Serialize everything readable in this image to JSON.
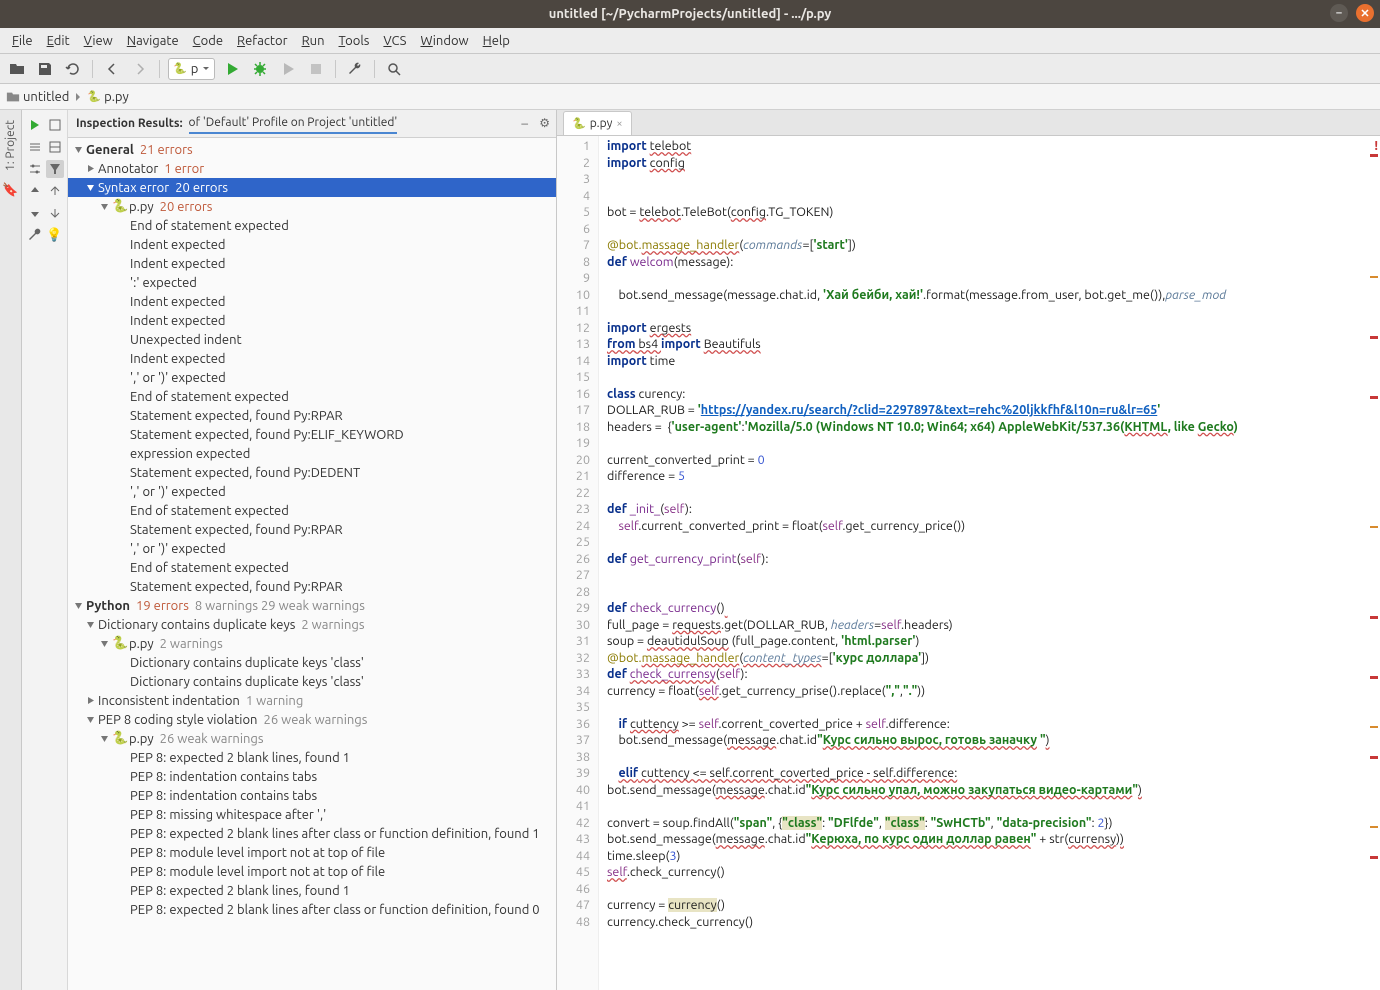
{
  "titlebar": {
    "title": "untitled [~/PycharmProjects/untitled] - .../p.py"
  },
  "menubar": [
    "File",
    "Edit",
    "View",
    "Navigate",
    "Code",
    "Refactor",
    "Run",
    "Tools",
    "VCS",
    "Window",
    "Help"
  ],
  "runconfig": {
    "label": "p"
  },
  "breadcrumb": [
    {
      "icon": "folder",
      "label": "untitled"
    },
    {
      "icon": "pyfile",
      "label": "p.py"
    }
  ],
  "sidebar": {
    "project_label": "1: Project"
  },
  "inspection": {
    "header_label": "Inspection Results:",
    "profile": "of 'Default' Profile on Project 'untitled'"
  },
  "tree": [
    {
      "d": 0,
      "tw": "down",
      "bold": true,
      "label": "General",
      "suffix": "21 errors",
      "cls": "err"
    },
    {
      "d": 1,
      "tw": "right",
      "label": "Annotator",
      "suffix": "1 error",
      "cls": "err"
    },
    {
      "d": 1,
      "tw": "down",
      "label": "Syntax error",
      "suffix": "20 errors",
      "cls": "err",
      "selected": true
    },
    {
      "d": 2,
      "tw": "down",
      "icon": "pyfile",
      "label": "p.py",
      "suffix": "20 errors",
      "cls": "err"
    },
    {
      "d": 3,
      "label": "End of statement expected"
    },
    {
      "d": 3,
      "label": "Indent expected"
    },
    {
      "d": 3,
      "label": "Indent expected"
    },
    {
      "d": 3,
      "label": "':' expected"
    },
    {
      "d": 3,
      "label": "Indent expected"
    },
    {
      "d": 3,
      "label": "Indent expected"
    },
    {
      "d": 3,
      "label": "Unexpected indent"
    },
    {
      "d": 3,
      "label": "Indent expected"
    },
    {
      "d": 3,
      "label": "',' or ')' expected"
    },
    {
      "d": 3,
      "label": "End of statement expected"
    },
    {
      "d": 3,
      "label": "Statement expected, found Py:RPAR"
    },
    {
      "d": 3,
      "label": "Statement expected, found Py:ELIF_KEYWORD"
    },
    {
      "d": 3,
      "label": "expression expected"
    },
    {
      "d": 3,
      "label": "Statement expected, found Py:DEDENT"
    },
    {
      "d": 3,
      "label": "',' or ')' expected"
    },
    {
      "d": 3,
      "label": "End of statement expected"
    },
    {
      "d": 3,
      "label": "Statement expected, found Py:RPAR"
    },
    {
      "d": 3,
      "label": "',' or ')' expected"
    },
    {
      "d": 3,
      "label": "End of statement expected"
    },
    {
      "d": 3,
      "label": "Statement expected, found Py:RPAR"
    },
    {
      "d": 0,
      "tw": "down",
      "bold": true,
      "label": "Python",
      "suffix": "19 errors",
      "cls": "err",
      "suffix2": "8 warnings 29 weak warnings",
      "cls2": "warn"
    },
    {
      "d": 1,
      "tw": "down",
      "label": "Dictionary contains duplicate keys",
      "suffix": "2 warnings",
      "cls": "warn"
    },
    {
      "d": 2,
      "tw": "down",
      "icon": "pyfile",
      "label": "p.py",
      "suffix": "2 warnings",
      "cls": "warn"
    },
    {
      "d": 3,
      "label": "Dictionary contains duplicate keys 'class'"
    },
    {
      "d": 3,
      "label": "Dictionary contains duplicate keys 'class'"
    },
    {
      "d": 1,
      "tw": "right",
      "label": "Inconsistent indentation",
      "suffix": "1 warning",
      "cls": "warn"
    },
    {
      "d": 1,
      "tw": "down",
      "label": "PEP 8 coding style violation",
      "suffix": "26 weak warnings",
      "cls": "warn"
    },
    {
      "d": 2,
      "tw": "down",
      "icon": "pyfile",
      "label": "p.py",
      "suffix": "26 weak warnings",
      "cls": "warn"
    },
    {
      "d": 3,
      "label": "PEP 8: expected 2 blank lines, found 1"
    },
    {
      "d": 3,
      "label": "PEP 8: indentation contains tabs"
    },
    {
      "d": 3,
      "label": "PEP 8: indentation contains tabs"
    },
    {
      "d": 3,
      "label": "PEP 8: missing whitespace after ','"
    },
    {
      "d": 3,
      "label": "PEP 8: expected 2 blank lines after class or function definition, found 1"
    },
    {
      "d": 3,
      "label": "PEP 8: module level import not at top of file"
    },
    {
      "d": 3,
      "label": "PEP 8: module level import not at top of file"
    },
    {
      "d": 3,
      "label": "PEP 8: expected 2 blank lines, found 1"
    },
    {
      "d": 3,
      "label": "PEP 8: expected 2 blank lines after class or function definition, found 0"
    }
  ],
  "editor": {
    "tab": "p.py",
    "lines_from": 1,
    "lines_to": 48,
    "code": [
      {
        "n": 1,
        "t": "<span class='kw'>import</span> <span class='squiggle'>telebot</span>"
      },
      {
        "n": 2,
        "t": "<span class='kw'>import</span> <span class='squiggle'>config</span>"
      },
      {
        "n": 3,
        "t": ""
      },
      {
        "n": 4,
        "t": ""
      },
      {
        "n": 5,
        "t": "bot = <span class='squiggle'>telebot</span>.TeleBot(<span class='squiggle'>config</span>.TG_TOKEN)"
      },
      {
        "n": 6,
        "t": ""
      },
      {
        "n": 7,
        "t": "<span class='dec'>@bot.<span class='squiggle'>massage_handler</span></span>(<span class='param'>commands</span>=[<span class='str'>'start'</span>])"
      },
      {
        "n": 8,
        "t": "<span class='kw'>def </span><span class='fn'>welcom</span>(message):"
      },
      {
        "n": 9,
        "t": ""
      },
      {
        "n": 10,
        "t": "    bot.send_message(message.chat.id, <span class='str'>'Хай бейби, хай!'</span>.format(message.from_user, bot.get_me()),<span class='param'>parse_mod</span>"
      },
      {
        "n": 11,
        "t": ""
      },
      {
        "n": 12,
        "t": "<span class='kw'>import</span> <span class='squiggle'>ergests</span>"
      },
      {
        "n": 13,
        "t": "<span class='kw'><span class='squiggle'>from</span></span><span class='squiggle'> bs4 </span><span class='kw'>import</span> <span class='squiggle'>Beautifuls</span>"
      },
      {
        "n": 14,
        "t": "<span class='kw'>import</span> time"
      },
      {
        "n": 15,
        "t": ""
      },
      {
        "n": 16,
        "t": "<span class='kw'>class</span> curency:"
      },
      {
        "n": 17,
        "t": "DOLLAR_RUB = <span class='str'>'<span class='url'>https://yandex.ru/search/?clid=2297897&amp;text=rehc%20ljkkfhf&amp;l10n=ru&amp;lr=65</span>'</span>"
      },
      {
        "n": 18,
        "t": "headers =  {<span class='str'>'user-agent'</span>:<span class='str'>'Mozilla/5.0 (Windows NT 10.0; Win64; x64) AppleWebKit/537.36(<span class='squiggle'>KHTML</span>, like <span class='squiggle'>Gecko</span>)</span>"
      },
      {
        "n": 19,
        "t": ""
      },
      {
        "n": 20,
        "t": "current_converted_print = <span class='num'>0</span>"
      },
      {
        "n": 21,
        "t": "difference = <span class='num'>5</span>"
      },
      {
        "n": 22,
        "t": ""
      },
      {
        "n": 23,
        "t": "<span class='kw'>def</span> <span class='fn'>_init_</span>(<span class='self'>self</span>):"
      },
      {
        "n": 24,
        "t": "    <span class='self'>self</span>.current_converted_print = float(<span class='self'>self</span>.get_currency_price())"
      },
      {
        "n": 25,
        "t": ""
      },
      {
        "n": 26,
        "t": "<span class='kw'>def</span> <span class='fn'>get_currency_print</span>(<span class='self'>self</span>):"
      },
      {
        "n": 27,
        "t": ""
      },
      {
        "n": 28,
        "t": ""
      },
      {
        "n": 29,
        "t": "<span class='kw'>def</span> <span class='fn'>check_currency</span>()<span class='squiggle'> </span>"
      },
      {
        "n": 30,
        "t": "full_page = <span class='squiggle'>requests</span>.get(DOLLAR_RUB, <span class='param'>headers</span>=<span class='self'>self</span>.headers)"
      },
      {
        "n": 31,
        "t": "soup = <span class='squiggle'>deautidulSoup</span> (full_page.content, <span class='str'>'html.parser'</span>)"
      },
      {
        "n": 32,
        "t": "<span class='dec'>@bot.<span class='squiggle'>massage_handler</span></span>(<span class='param'><span class='squiggle'>content_types</span></span>=[<span class='str'>'курс доллара'</span>])"
      },
      {
        "n": 33,
        "t": "<span class='kw'>def</span> <span class='fn'><span class='squiggle'>check_currensy</span></span>(<span class='self'>self</span>):"
      },
      {
        "n": 34,
        "t": "currency = float(<span class='self squiggle'>self</span>.get_currency_prise().replace(<span class='str'>\",\"</span>,<span class='str'>\".\"</span>))"
      },
      {
        "n": 35,
        "t": ""
      },
      {
        "n": 36,
        "t": "    <span class='kw'>if</span> <span class='squiggle'>cuttency</span> &gt;= <span class='self'>self</span>.corrent_coverted_price + <span class='self'>self</span>.difference:"
      },
      {
        "n": 37,
        "t": "    bot.send_message(<span class='squiggle'>message</span>.chat.id<span class='str'>\"<span class='squiggle'>Курс сильно вырос, готовь заначку</span> \"</span><span class='squiggle'>)</span>"
      },
      {
        "n": 38,
        "t": ""
      },
      {
        "n": 39,
        "t": "    <span class='kw squiggle'>elif</span><span class='squiggle'> cuttency &lt;= self.corrent_coverted_price - self.difference:</span>"
      },
      {
        "n": 40,
        "t": "bot.send_message(<span class='squiggle'>message</span>.chat.id<span class='str'>\"<span class='squiggle'>Курс сильно упал, можно закупаться видео-картами</span>\"</span><span class='squiggle'>)</span>"
      },
      {
        "n": 41,
        "t": ""
      },
      {
        "n": 42,
        "t": "convert = soup.findAll(<span class='str'>\"span\"</span>, {<span class='str hl'>\"class\"</span>: <span class='str'>\"DFlfde\"</span>, <span class='str hl'>\"class\"</span>: <span class='str'>\"SwHCTb\"</span>, <span class='str'>\"data-precision\"</span>: <span class='num'>2</span>})"
      },
      {
        "n": 43,
        "t": "bot.send_message(<span class='squiggle'>message</span>.chat.id<span class='str'>\"<span class='squiggle'>Керюха, по курс один доллар равен</span>\"</span> + str(<span class='squiggle'>currensy</span>)<span class='squiggle'>)</span>"
      },
      {
        "n": 44,
        "t": "time.sleep(<span class='num'>3</span>)"
      },
      {
        "n": 45,
        "t": "<span class='self squiggle'>self</span>.check_currency()"
      },
      {
        "n": 46,
        "t": ""
      },
      {
        "n": 47,
        "t": "currency = <span class='hl'>currency</span>()"
      },
      {
        "n": 48,
        "t": "currency.check_currency()"
      }
    ]
  }
}
